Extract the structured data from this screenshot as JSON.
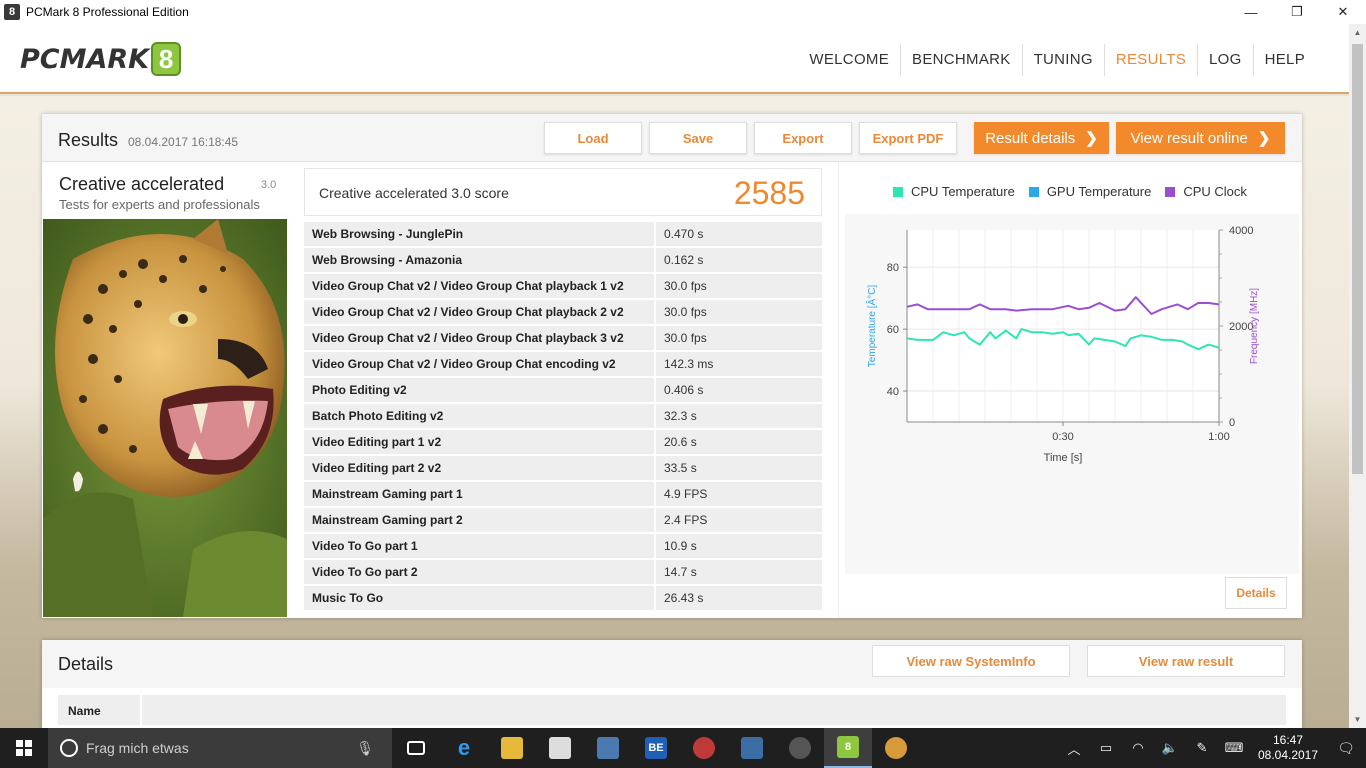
{
  "window": {
    "title": "PCMark 8 Professional Edition",
    "app_icon": "8",
    "controls": {
      "minimize": "—",
      "maximize": "❐",
      "close": "✕"
    }
  },
  "header": {
    "logo_text": "PCMARK",
    "logo_badge": "8",
    "nav": [
      {
        "label": "WELCOME",
        "active": false
      },
      {
        "label": "BENCHMARK",
        "active": false
      },
      {
        "label": "TUNING",
        "active": false
      },
      {
        "label": "RESULTS",
        "active": true
      },
      {
        "label": "LOG",
        "active": false
      },
      {
        "label": "HELP",
        "active": false
      }
    ]
  },
  "results": {
    "title": "Results",
    "date": "08.04.2017 16:18:45",
    "buttons": {
      "load": "Load",
      "save": "Save",
      "export": "Export",
      "export_pdf": "Export PDF",
      "result_details": "Result details",
      "view_online": "View result online",
      "chevron": "❯"
    },
    "test": {
      "name": "Creative accelerated",
      "version": "3.0",
      "description": "Tests for experts and professionals"
    },
    "score": {
      "label": "Creative accelerated 3.0 score",
      "value": "2585"
    },
    "rows": [
      {
        "name": "Web Browsing - JunglePin",
        "value": "0.470 s"
      },
      {
        "name": "Web Browsing - Amazonia",
        "value": "0.162 s"
      },
      {
        "name": "Video Group Chat v2 / Video Group Chat playback 1 v2",
        "value": "30.0 fps"
      },
      {
        "name": "Video Group Chat v2 / Video Group Chat playback 2 v2",
        "value": "30.0 fps"
      },
      {
        "name": "Video Group Chat v2 / Video Group Chat playback 3 v2",
        "value": "30.0 fps"
      },
      {
        "name": "Video Group Chat v2 / Video Group Chat encoding v2",
        "value": "142.3 ms"
      },
      {
        "name": "Photo Editing v2",
        "value": "0.406 s"
      },
      {
        "name": "Batch Photo Editing v2",
        "value": "32.3 s"
      },
      {
        "name": "Video Editing part 1 v2",
        "value": "20.6 s"
      },
      {
        "name": "Video Editing part 2 v2",
        "value": "33.5 s"
      },
      {
        "name": "Mainstream Gaming part 1",
        "value": "4.9 FPS"
      },
      {
        "name": "Mainstream Gaming part 2",
        "value": "2.4 FPS"
      },
      {
        "name": "Video To Go part 1",
        "value": "10.9 s"
      },
      {
        "name": "Video To Go part 2",
        "value": "14.7 s"
      },
      {
        "name": "Music To Go",
        "value": "26.43 s"
      }
    ],
    "details_button": "Details"
  },
  "chart_data": {
    "type": "line",
    "legend": [
      {
        "name": "CPU Temperature",
        "color": "#2ee6b4"
      },
      {
        "name": "GPU Temperature",
        "color": "#2aa9e8"
      },
      {
        "name": "CPU Clock",
        "color": "#9b4fd0"
      }
    ],
    "xlabel": "Time [s]",
    "ylabel_left": "Temperature [Â°C]",
    "ylabel_right": "Frequency [MHz]",
    "x_ticks": [
      "0:30",
      "1:00"
    ],
    "x_tick_values": [
      30,
      60
    ],
    "xlim": [
      0,
      60
    ],
    "y_left_ticks": [
      "40",
      "60",
      "80"
    ],
    "y_left_tick_values": [
      40,
      60,
      80
    ],
    "ylim_left": [
      30,
      92
    ],
    "y_right_ticks": [
      "0",
      "2000",
      "4000"
    ],
    "y_right_tick_values": [
      0,
      2000,
      4000
    ],
    "ylim_right": [
      0,
      4000
    ],
    "grid": true,
    "series": [
      {
        "name": "CPU Temperature",
        "axis": "left",
        "color": "#2ee6b4",
        "x": [
          0,
          2,
          5,
          7,
          9,
          11,
          12,
          14,
          16,
          17,
          19,
          21,
          22,
          24,
          26,
          28,
          30,
          31,
          33,
          35,
          36,
          38,
          40,
          42,
          43,
          45,
          47,
          49,
          51,
          53,
          54,
          56,
          58,
          60
        ],
        "values": [
          57,
          56.5,
          56.5,
          59,
          58,
          59,
          57,
          55,
          59,
          57,
          59.5,
          57,
          60,
          59,
          59,
          58.5,
          59,
          58,
          58.5,
          55,
          57,
          56.5,
          56,
          54.5,
          57,
          58,
          57.5,
          56.5,
          56.5,
          56,
          55,
          53.5,
          55,
          54
        ]
      },
      {
        "name": "CPU Clock",
        "axis": "right",
        "color": "#9b4fd0",
        "x": [
          0,
          2,
          4,
          7,
          9,
          12,
          14,
          16,
          19,
          21,
          24,
          26,
          28,
          31,
          33,
          35,
          37,
          40,
          42,
          44,
          47,
          49,
          52,
          54,
          56,
          58,
          60
        ],
        "values": [
          2400,
          2450,
          2350,
          2350,
          2350,
          2350,
          2450,
          2350,
          2350,
          2320,
          2350,
          2350,
          2350,
          2420,
          2350,
          2380,
          2480,
          2320,
          2350,
          2600,
          2250,
          2350,
          2450,
          2350,
          2480,
          2480,
          2450
        ]
      }
    ]
  },
  "details": {
    "title": "Details",
    "view_sysinfo": "View raw SystemInfo",
    "view_result": "View raw result",
    "col_name": "Name"
  },
  "taskbar": {
    "search_placeholder": "Frag mich etwas",
    "time": "16:47",
    "date": "08.04.2017"
  }
}
